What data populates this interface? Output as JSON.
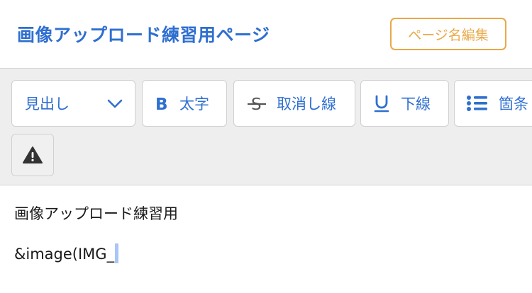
{
  "header": {
    "title": "画像アップロード練習用ページ",
    "edit_button": "ページ名編集"
  },
  "toolbar": {
    "heading": "見出し",
    "bold": "太字",
    "strikethrough": "取消し線",
    "underline": "下線",
    "list": "箇条"
  },
  "editor": {
    "line1": "画像アップロード練習用",
    "line2": "&image(IMG_"
  },
  "colors": {
    "accent": "#2f6fd0",
    "edit_button": "#e9a948",
    "toolbar_bg": "#eeeeee"
  },
  "icons": [
    "chevron-down-icon",
    "bold-icon",
    "strikethrough-icon",
    "underline-icon",
    "list-icon",
    "warning-icon"
  ]
}
